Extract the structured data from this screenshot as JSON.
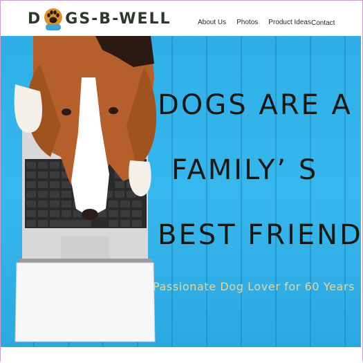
{
  "header": {
    "logo": {
      "text_left": "D",
      "text_right": "GS-B-WELL"
    },
    "nav": [
      {
        "label": "About Us"
      },
      {
        "label": "Photos"
      },
      {
        "label": "Product Ideas"
      },
      {
        "label": "Contact"
      }
    ]
  },
  "hero": {
    "headline": [
      "DOGS ARE A",
      "FAMILY’ S",
      "BEST FRIEND"
    ],
    "subtitle": "Passionate Dog Lover for 60 Years"
  },
  "colors": {
    "background_blue": "#2eaee6",
    "headline": "#1a1712",
    "subtitle": "#f3d28a",
    "paw_orange": "#e0922a"
  },
  "icons": {
    "logo_paw": "paw-icon"
  }
}
